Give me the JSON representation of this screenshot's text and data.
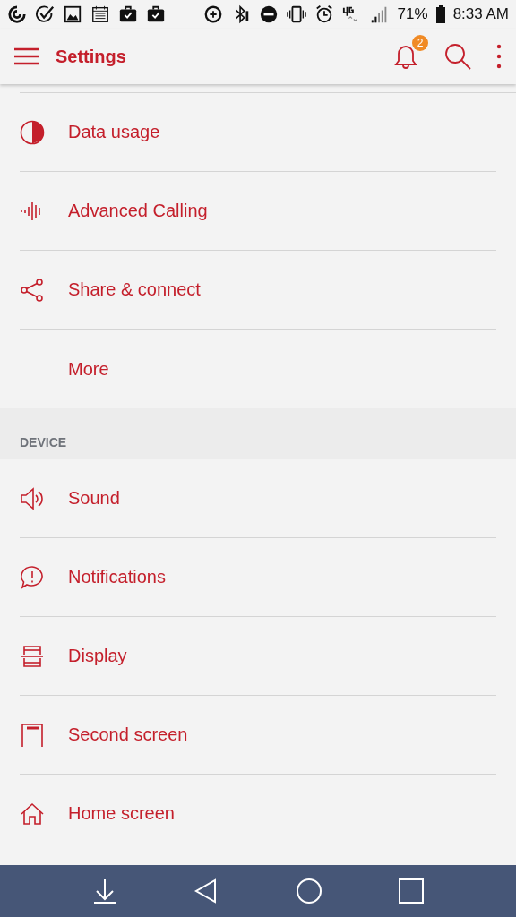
{
  "status_bar": {
    "battery": "71%",
    "time": "8:33 AM"
  },
  "app_bar": {
    "title": "Settings",
    "notification_count": "2"
  },
  "sections": [
    {
      "items": [
        {
          "label": "Data usage",
          "kind": "data"
        },
        {
          "label": "Advanced Calling",
          "kind": "calling"
        },
        {
          "label": "Share & connect",
          "kind": "share"
        },
        {
          "label": "More",
          "kind": "plain"
        }
      ]
    },
    {
      "header": "DEVICE",
      "items": [
        {
          "label": "Sound",
          "kind": "sound"
        },
        {
          "label": "Notifications",
          "kind": "notifications"
        },
        {
          "label": "Display",
          "kind": "display"
        },
        {
          "label": "Second screen",
          "kind": "screen"
        },
        {
          "label": "Home screen",
          "kind": "home"
        }
      ]
    }
  ]
}
